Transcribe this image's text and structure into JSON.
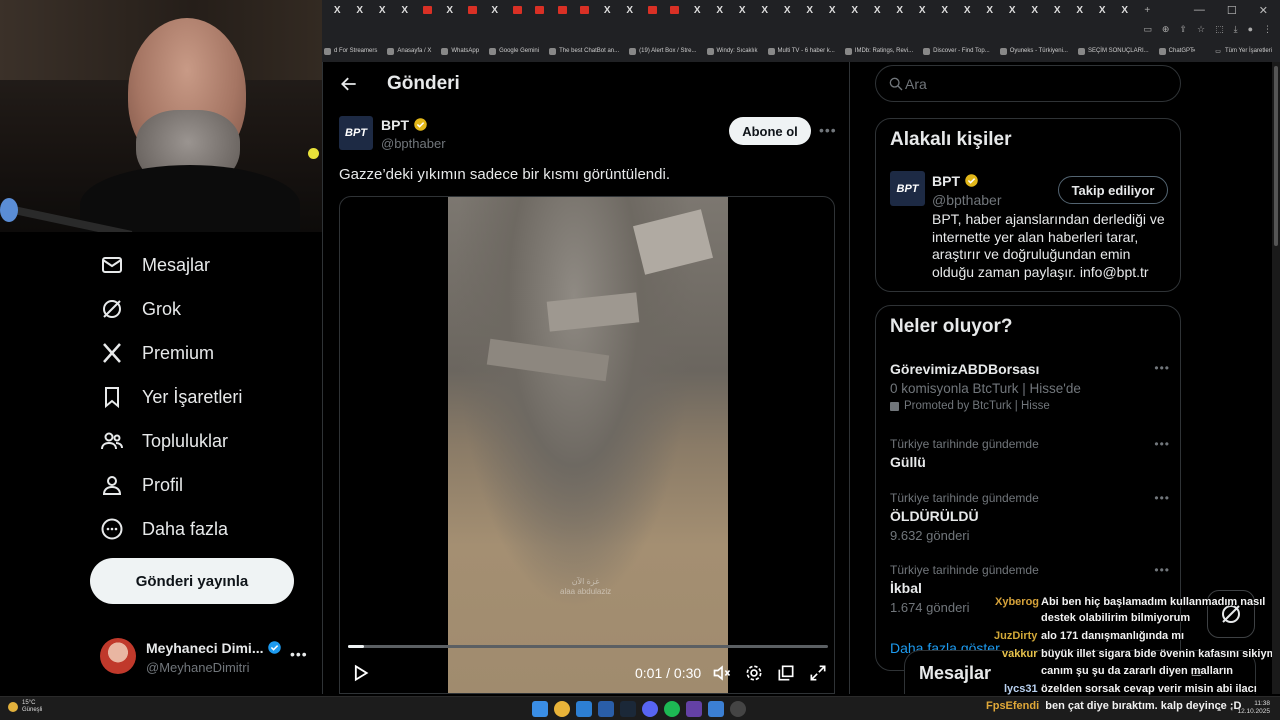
{
  "browser": {
    "tab_glyph": "X",
    "bookmarks": [
      "d For Streamers",
      "Anasayfa / X",
      "WhatsApp",
      "Google Gemini",
      "The best ChatBot an...",
      "(19) Alert Box / Stre...",
      "Windy: Sıcaklık",
      "Multi TV - 6 haber k...",
      "IMDb: Ratings, Revi...",
      "Discover - Find Top...",
      "Oyuneks - Türkiyeni...",
      "SEÇİM SONUÇLARI...",
      "ChatGPT"
    ],
    "bookmarks_more": "»",
    "all_bookmarks": "Tüm Yer İşaretleri"
  },
  "nav": {
    "items": [
      {
        "label": "Mesajlar",
        "icon": "envelope-icon"
      },
      {
        "label": "Grok",
        "icon": "grok-icon"
      },
      {
        "label": "Premium",
        "icon": "x-logo-icon"
      },
      {
        "label": "Yer İşaretleri",
        "icon": "bookmark-icon"
      },
      {
        "label": "Topluluklar",
        "icon": "people-icon"
      },
      {
        "label": "Profil",
        "icon": "person-icon"
      },
      {
        "label": "Daha fazla",
        "icon": "more-circle-icon"
      }
    ],
    "post_button": "Gönderi yayınla",
    "account": {
      "name": "Meyhaneci Dimi...",
      "handle": "@MeyhaneDimitri",
      "more": "•••"
    }
  },
  "main": {
    "title": "Gönderi",
    "author": {
      "name": "BPT",
      "handle": "@bpthaber",
      "avatar_text": "BPT"
    },
    "subscribe": "Abone ol",
    "more": "•••",
    "text": "Gazze’deki yıkımın sadece bir kısmı görüntülendi.",
    "video": {
      "time": "0:01 / 0:30",
      "progress": 0.033,
      "watermark": "غزة الآن\nalaa abdulaziz"
    }
  },
  "sidebar": {
    "search_placeholder": "Ara",
    "related": {
      "title": "Alakalı kişiler",
      "name": "BPT",
      "handle": "@bpthaber",
      "avatar_text": "BPT",
      "button": "Takip ediliyor",
      "bio": "BPT, haber ajanslarından derlediği ve internette yer alan haberleri tarar, araştırır ve doğruluğundan emin olduğu zaman paylaşır. info@bpt.tr"
    },
    "trends": {
      "title": "Neler oluyor?",
      "items": [
        {
          "category": "",
          "title": "GörevimizABDBorsası",
          "subtitle": "0 komisyonla BtcTurk | Hisse'de",
          "promo": "Promoted by BtcTurk | Hisse"
        },
        {
          "category": "Türkiye tarihinde gündemde",
          "title": "Güllü",
          "subtitle": ""
        },
        {
          "category": "Türkiye tarihinde gündemde",
          "title": "ÖLDÜRÜLDÜ",
          "subtitle": "9.632 gönderi"
        },
        {
          "category": "Türkiye tarihinde gündemde",
          "title": "İkbal",
          "subtitle": "1.674 gönderi"
        }
      ],
      "show_more": "Daha fazla göster",
      "dots": "•••"
    }
  },
  "messages_drawer": {
    "title": "Mesajlar"
  },
  "chat": [
    {
      "user": "Xyberog",
      "lines": [
        "Abi ben hiç başlamadım kullanmadım nasıl",
        "destek olabilirim bilmiyorum"
      ]
    },
    {
      "user": "JuzDirty",
      "lines": [
        "alo 171 danışmanlığında mı"
      ]
    },
    {
      "user": "vakkur",
      "lines": [
        "büyük illet sigara bide övenin kafasını sikiym",
        "canım şu şu da zararlı diyen malların"
      ]
    },
    {
      "user": "lycs31",
      "lines": [
        "özelden sorsak cevap verir misin abi ilacı"
      ]
    },
    {
      "user": "FpsEfendi",
      "lines": [
        "ben çat diye bıraktım. kalp deyince :D"
      ]
    }
  ],
  "taskbar": {
    "weather_temp": "15°C",
    "weather_desc": "Güneşli",
    "time": "11:38",
    "date": "12.10.2025"
  },
  "colors": {
    "accent": "#1d9bf0",
    "verified": "#1d9bf0",
    "gold_verified": "#e2b719",
    "background": "#000000"
  }
}
